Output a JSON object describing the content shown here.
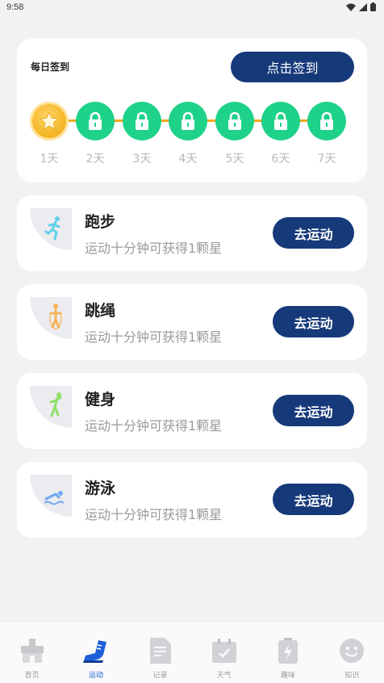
{
  "status_bar": {
    "time": "9:58"
  },
  "checkin": {
    "title": "每日签到",
    "button_label": "点击签到",
    "days": [
      "1天",
      "2天",
      "3天",
      "4天",
      "5天",
      "6天",
      "7天"
    ]
  },
  "sports": [
    {
      "name": "跑步",
      "desc": "运动十分钟可获得1颗星",
      "button": "去运动",
      "icon": "running-icon"
    },
    {
      "name": "跳绳",
      "desc": "运动十分钟可获得1颗星",
      "button": "去运动",
      "icon": "jump-rope-icon"
    },
    {
      "name": "健身",
      "desc": "运动十分钟可获得1颗星",
      "button": "去运动",
      "icon": "fitness-icon"
    },
    {
      "name": "游泳",
      "desc": "运动十分钟可获得1颗星",
      "button": "去运动",
      "icon": "swimming-icon"
    }
  ],
  "nav": {
    "items": [
      {
        "label": "首页",
        "icon": "home-icon"
      },
      {
        "label": "运动",
        "icon": "shoe-icon",
        "active": true
      },
      {
        "label": "记录",
        "icon": "notes-icon"
      },
      {
        "label": "天气",
        "icon": "calendar-icon"
      },
      {
        "label": "趣味",
        "icon": "battery-icon"
      },
      {
        "label": "知识",
        "icon": "smiley-icon"
      }
    ]
  },
  "colors": {
    "primary": "#16397a",
    "lock_green": "#1fd28a",
    "progress_orange": "#f2a91e",
    "nav_active": "#1d5fd8"
  }
}
